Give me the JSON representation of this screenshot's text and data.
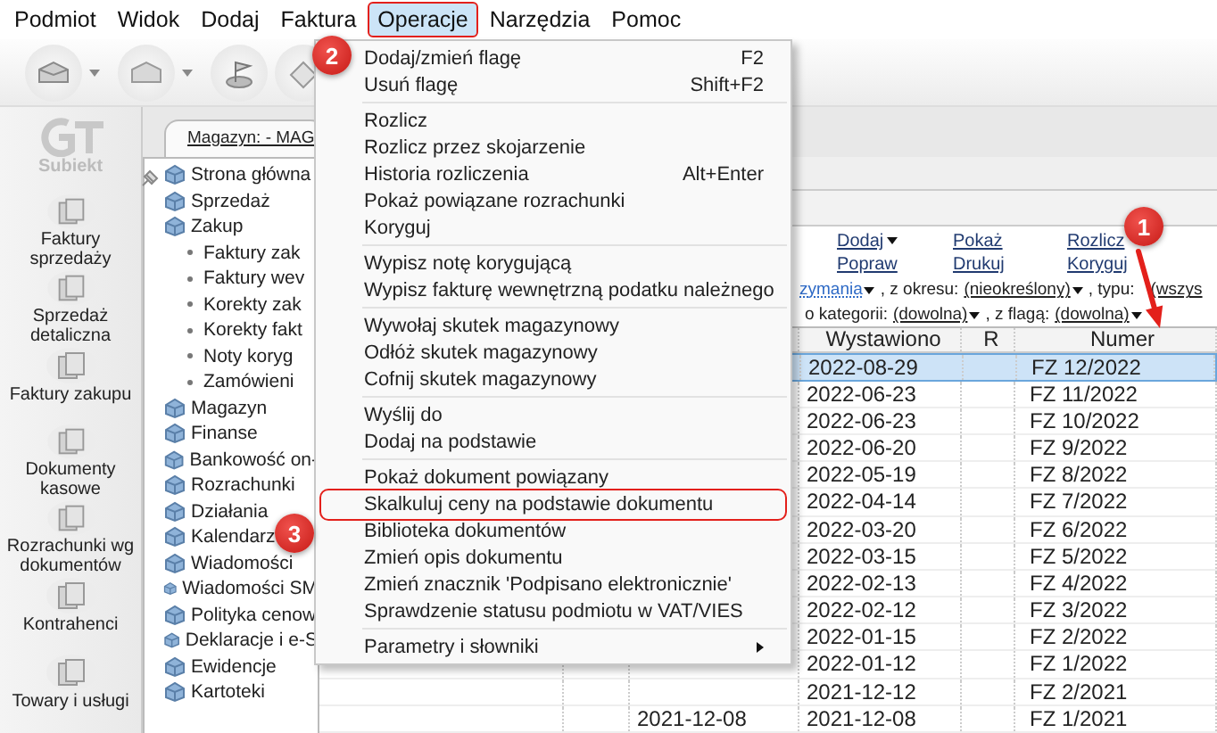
{
  "menubar": [
    {
      "label": "Podmiot",
      "selected": false
    },
    {
      "label": "Widok",
      "selected": false
    },
    {
      "label": "Dodaj",
      "selected": false
    },
    {
      "label": "Faktura",
      "selected": false
    },
    {
      "label": "Operacje",
      "selected": true,
      "outlined": true
    },
    {
      "label": "Narzędzia",
      "selected": false
    },
    {
      "label": "Pomoc",
      "selected": false
    }
  ],
  "logo": {
    "label": "Subiekt"
  },
  "sidebar": {
    "items": [
      {
        "label": "Faktury sprzedaży"
      },
      {
        "label": "Sprzedaż detaliczna"
      },
      {
        "label": "Faktury zakupu"
      },
      {
        "label": "Dokumenty kasowe"
      },
      {
        "label": "Rozrachunki wg dokumentów"
      },
      {
        "label": "Kontrahenci"
      },
      {
        "label": "Towary i usługi"
      }
    ]
  },
  "tab": {
    "label": "Magazyn: - MAG"
  },
  "tree": [
    {
      "label": "Strona główna"
    },
    {
      "label": "Sprzedaż"
    },
    {
      "label": "Zakup",
      "children": [
        {
          "label": "Faktury zak"
        },
        {
          "label": "Faktury wev"
        },
        {
          "label": "Korekty zak"
        },
        {
          "label": "Korekty fakt"
        },
        {
          "label": "Noty koryg"
        },
        {
          "label": "Zamówieni"
        }
      ]
    },
    {
      "label": "Magazyn"
    },
    {
      "label": "Finanse"
    },
    {
      "label": "Bankowość on-"
    },
    {
      "label": "Rozrachunki"
    },
    {
      "label": "Działania"
    },
    {
      "label": "Kalendarz"
    },
    {
      "label": "Wiadomości"
    },
    {
      "label": "Wiadomości SM"
    },
    {
      "label": "Polityka cenow"
    },
    {
      "label": "Deklaracje i e-S"
    },
    {
      "label": "Ewidencje"
    },
    {
      "label": "Kartoteki"
    }
  ],
  "actions": [
    {
      "label": "Dodaj",
      "dropdown": true
    },
    {
      "label": "Popraw",
      "dropdown": false
    },
    {
      "label": "Pokaż",
      "dropdown": false
    },
    {
      "label": "Drukuj",
      "dropdown": false
    },
    {
      "label": "Rozlicz",
      "dropdown": false
    },
    {
      "label": "Koryguj",
      "dropdown": false
    }
  ],
  "filters": [
    [
      {
        "kind": "link",
        "label": "zymania",
        "dropdown": true
      },
      {
        "kind": "text",
        "label": ", z okresu:"
      },
      {
        "kind": "value",
        "label": "(nieokreślony)",
        "dropdown": true
      },
      {
        "kind": "text",
        "label": ", typu:"
      },
      {
        "kind": "value",
        "label": "(wszys",
        "dropdown": false
      }
    ],
    [
      {
        "kind": "text",
        "label": "o kategorii:"
      },
      {
        "kind": "value",
        "label": "(dowolna)",
        "dropdown": true
      },
      {
        "kind": "text",
        "label": ", z flagą:"
      },
      {
        "kind": "value",
        "label": "(dowolna)",
        "dropdown": true
      }
    ]
  ],
  "table": {
    "columns": [
      {
        "label": "Wystawiono"
      },
      {
        "label": "R"
      },
      {
        "label": "Numer"
      }
    ],
    "rows": [
      {
        "issued": "2022-08-29",
        "number": "FZ 12/2022",
        "selected": true
      },
      {
        "issued": "2022-06-23",
        "number": "FZ 11/2022",
        "selected": false
      },
      {
        "issued": "2022-06-23",
        "number": "FZ 10/2022",
        "selected": false
      },
      {
        "issued": "2022-06-20",
        "number": "FZ 9/2022",
        "selected": false
      },
      {
        "issued": "2022-05-19",
        "number": "FZ 8/2022",
        "selected": false
      },
      {
        "issued": "2022-04-14",
        "number": "FZ 7/2022",
        "selected": false
      },
      {
        "issued": "2022-03-20",
        "number": "FZ 6/2022",
        "selected": false
      },
      {
        "issued": "2022-03-15",
        "number": "FZ 5/2022",
        "selected": false
      },
      {
        "issued": "2022-02-13",
        "number": "FZ 4/2022",
        "selected": false
      },
      {
        "issued": "2022-02-12",
        "number": "FZ 3/2022",
        "selected": false
      },
      {
        "issued": "2022-01-15",
        "number": "FZ 2/2022",
        "selected": false
      },
      {
        "issued": "2022-01-12",
        "number": "FZ 1/2022",
        "selected": false
      },
      {
        "issued": "2021-12-12",
        "number": "FZ 2/2021",
        "selected": false
      },
      {
        "received": "2021-12-08",
        "issued": "2021-12-08",
        "number": "FZ 1/2021",
        "selected": false
      }
    ]
  },
  "menu": {
    "items": [
      {
        "kind": "item",
        "label": "Dodaj/zmień flagę",
        "shortcut": "F2"
      },
      {
        "kind": "item",
        "label": "Usuń flagę",
        "shortcut": "Shift+F2"
      },
      {
        "kind": "separator"
      },
      {
        "kind": "item",
        "label": "Rozlicz"
      },
      {
        "kind": "item",
        "label": "Rozlicz przez skojarzenie"
      },
      {
        "kind": "item",
        "label": "Historia rozliczenia",
        "shortcut": "Alt+Enter"
      },
      {
        "kind": "item",
        "label": "Pokaż powiązane rozrachunki"
      },
      {
        "kind": "item",
        "label": "Koryguj"
      },
      {
        "kind": "separator"
      },
      {
        "kind": "item",
        "label": "Wypisz notę korygującą"
      },
      {
        "kind": "item",
        "label": "Wypisz fakturę wewnętrzną podatku należnego"
      },
      {
        "kind": "separator"
      },
      {
        "kind": "item",
        "label": "Wywołaj skutek magazynowy"
      },
      {
        "kind": "item",
        "label": "Odłóż skutek magazynowy"
      },
      {
        "kind": "item",
        "label": "Cofnij skutek magazynowy"
      },
      {
        "kind": "separator"
      },
      {
        "kind": "item",
        "label": "Wyślij do"
      },
      {
        "kind": "item",
        "label": "Dodaj na podstawie"
      },
      {
        "kind": "separator"
      },
      {
        "kind": "item",
        "label": "Pokaż dokument powiązany"
      },
      {
        "kind": "item",
        "label": "Skalkuluj ceny na podstawie dokumentu",
        "outlined": true
      },
      {
        "kind": "item",
        "label": "Biblioteka dokumentów"
      },
      {
        "kind": "item",
        "label": "Zmień opis dokumentu"
      },
      {
        "kind": "item",
        "label": "Zmień znacznik 'Podpisano elektronicznie'"
      },
      {
        "kind": "item",
        "label": "Sprawdzenie statusu podmiotu w VAT/VIES"
      },
      {
        "kind": "separator"
      },
      {
        "kind": "item",
        "label": "Parametry i słowniki",
        "submenu": true
      }
    ]
  },
  "annotations": [
    {
      "label": "1"
    },
    {
      "label": "2"
    },
    {
      "label": "3"
    }
  ]
}
